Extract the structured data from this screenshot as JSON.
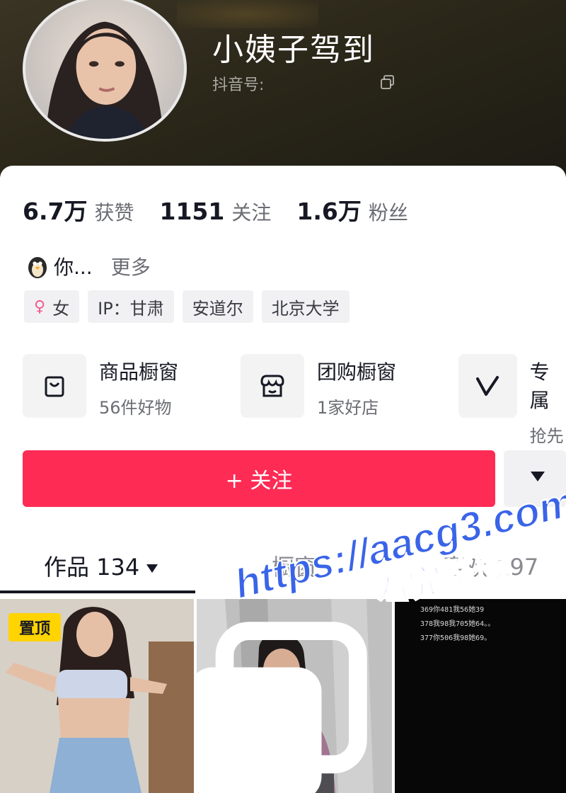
{
  "profile": {
    "name": "小姨子驾到",
    "douyin_id_label": "抖音号:"
  },
  "stats": [
    {
      "value": "6.7万",
      "label": "获赞"
    },
    {
      "value": "1151",
      "label": "关注"
    },
    {
      "value": "1.6万",
      "label": "粉丝"
    }
  ],
  "bio": {
    "text": "你...",
    "more": "更多"
  },
  "tags": {
    "gender": "女",
    "ip": "IP：甘肃",
    "city": "安道尔",
    "school": "北京大学"
  },
  "shops": [
    {
      "title": "商品橱窗",
      "sub": "56件好物"
    },
    {
      "title": "团购橱窗",
      "sub": "1家好店"
    },
    {
      "title": "专属",
      "sub": "抢先"
    }
  ],
  "actions": {
    "follow": "+ 关注"
  },
  "tabs": [
    {
      "label": "作品 134"
    },
    {
      "label": "橱窗"
    },
    {
      "label": "喜欢 197"
    }
  ],
  "grid": {
    "pinned_label": "置顶",
    "chat_lines": [
      "369你481我56她39",
      "378我98我705她64。。",
      "377你506我98她69。"
    ]
  },
  "watermark": {
    "url": "https://aacg3.com",
    "caption": "看完整版"
  },
  "colors": {
    "accent": "#fe2c55",
    "pin": "#ffd400",
    "watermark": "#3a64e8"
  }
}
